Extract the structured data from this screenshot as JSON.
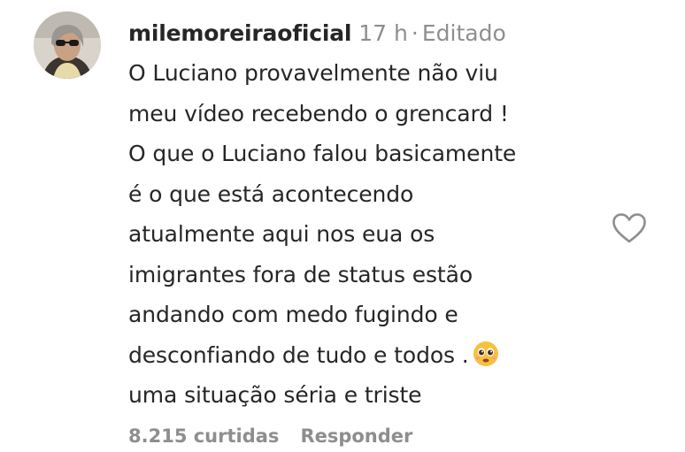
{
  "comment": {
    "username": "milemoreiraoficial",
    "time": "17 h",
    "separator": "·",
    "edited": "Editado",
    "lines": [
      "O Luciano provavelmente não viu",
      "meu vídeo recebendo o grencard !",
      "O que o Luciano falou basicamente",
      "é o que está acontecendo",
      "atualmente aqui nos eua os",
      "imigrantes fora de status estão",
      "andando com medo fugindo e",
      "desconfiando de tudo e todos .",
      "uma situação séria e triste"
    ],
    "emoji": "pleading-face-emoji"
  },
  "footer": {
    "likes": "8.215 curtidas",
    "reply": "Responder"
  },
  "icons": {
    "avatar": "profile-photo",
    "like": "heart-outline-icon"
  },
  "colors": {
    "text": "#262626",
    "secondary": "#8e8e8e",
    "background": "#ffffff"
  }
}
